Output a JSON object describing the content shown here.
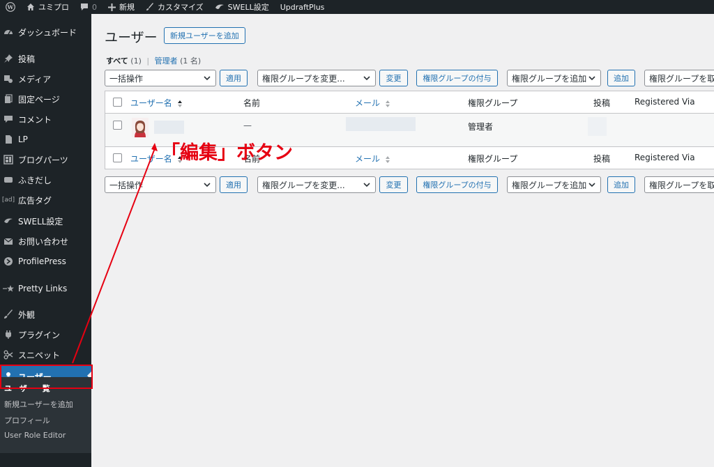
{
  "adminbar": {
    "site_name": "ユミプロ",
    "comments_count": "0",
    "new_label": "新規",
    "customize_label": "カスタマイズ",
    "swell_label": "SWELL設定",
    "updraft_label": "UpdraftPlus"
  },
  "sidebar": {
    "items": [
      {
        "label": "ダッシュボード",
        "icon": "dashboard-icon"
      },
      {
        "label": "投稿",
        "icon": "pin-icon"
      },
      {
        "label": "メディア",
        "icon": "media-icon"
      },
      {
        "label": "固定ページ",
        "icon": "page-icon"
      },
      {
        "label": "コメント",
        "icon": "comment-icon"
      },
      {
        "label": "LP",
        "icon": "document-icon"
      },
      {
        "label": "ブログパーツ",
        "icon": "grid-icon"
      },
      {
        "label": "ふきだし",
        "icon": "speech-bubble-icon"
      },
      {
        "label": "広告タグ",
        "icon": "ad-icon"
      },
      {
        "label": "SWELL設定",
        "icon": "swell-icon"
      },
      {
        "label": "お問い合わせ",
        "icon": "mail-icon"
      },
      {
        "label": "ProfilePress",
        "icon": "profilepress-icon"
      },
      {
        "label": "Pretty Links",
        "icon": "star-icon"
      },
      {
        "label": "外観",
        "icon": "brush-icon"
      },
      {
        "label": "プラグイン",
        "icon": "plugin-icon"
      },
      {
        "label": "スニペット",
        "icon": "scissors-icon"
      },
      {
        "label": "ユーザー",
        "icon": "user-icon"
      }
    ],
    "ad_icon_text": "[ad]",
    "submenu": [
      "ユーザー一覧",
      "新規ユーザーを追加",
      "プロフィール",
      "User Role Editor"
    ]
  },
  "page": {
    "title": "ユーザー",
    "add_new_button": "新規ユーザーを追加",
    "filter_all": "すべて",
    "filter_all_count": "(1)",
    "filter_admin": "管理者",
    "filter_admin_count": "(1 名)",
    "filter_separator": "|"
  },
  "tablenav": {
    "bulk_action": "一括操作",
    "apply": "適用",
    "change_role": "権限グループを変更...",
    "change": "変更",
    "grant_role": "権限グループの付与",
    "add_role": "権限グループを追加",
    "add": "追加",
    "remove_role": "権限グループを取"
  },
  "table": {
    "columns": {
      "username": "ユーザー名",
      "name": "名前",
      "email": "メール",
      "role": "権限グループ",
      "posts": "投稿",
      "registered_via": "Registered Via"
    },
    "rows": [
      {
        "name": "—",
        "role": "管理者"
      }
    ]
  },
  "annotation": {
    "text": "「編集」ボタン",
    "color": "#e60012"
  },
  "colors": {
    "sidebar_bg": "#1d2327",
    "accent": "#2271b1",
    "annotation": "#e60012"
  }
}
